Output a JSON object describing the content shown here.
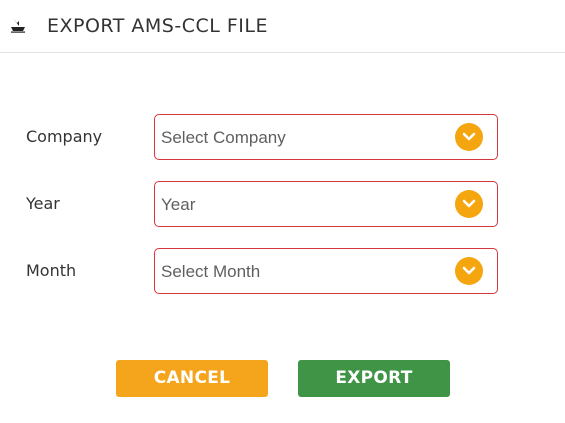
{
  "header": {
    "title": "EXPORT AMS-CCL FILE",
    "icon": "ship-icon"
  },
  "form": {
    "company": {
      "label": "Company",
      "value": "Select Company"
    },
    "year": {
      "label": "Year",
      "value": "Year"
    },
    "month": {
      "label": "Month",
      "value": "Select Month"
    }
  },
  "buttons": {
    "cancel": "CANCEL",
    "export": "EXPORT"
  },
  "colors": {
    "accent": "#f5a50e",
    "border": "#d9363e",
    "export": "#3f9445",
    "cancel": "#f5a51c"
  }
}
